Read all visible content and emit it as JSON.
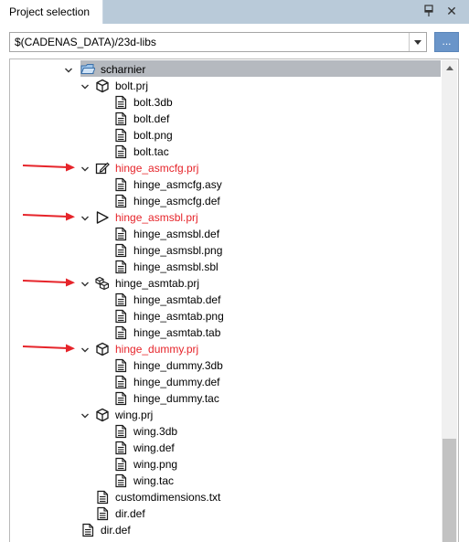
{
  "window": {
    "tab_title": "Project selection",
    "close_glyph": "✕"
  },
  "path": {
    "value": "$(CADENAS_DATA)/23d-libs",
    "browse_label": "..."
  },
  "colors": {
    "highlight_text": "#e6242a",
    "selected_row": "#b5b9bf",
    "arrow": "#e6242a"
  },
  "tree": [
    {
      "label": "scharnier",
      "icon": "folder-open-icon",
      "expanded": true,
      "selected": true
    },
    {
      "label": "bolt.prj",
      "icon": "cube-icon",
      "expanded": true
    },
    {
      "label": "bolt.3db",
      "icon": "document-icon"
    },
    {
      "label": "bolt.def",
      "icon": "document-icon"
    },
    {
      "label": "bolt.png",
      "icon": "document-icon"
    },
    {
      "label": "bolt.tac",
      "icon": "document-icon"
    },
    {
      "label": "hinge_asmcfg.prj",
      "icon": "edit-icon",
      "expanded": true,
      "highlighted": true
    },
    {
      "label": "hinge_asmcfg.asy",
      "icon": "document-icon"
    },
    {
      "label": "hinge_asmcfg.def",
      "icon": "document-icon"
    },
    {
      "label": "hinge_asmsbl.prj",
      "icon": "triangle-icon",
      "expanded": true,
      "highlighted": true
    },
    {
      "label": "hinge_asmsbl.def",
      "icon": "document-icon"
    },
    {
      "label": "hinge_asmsbl.png",
      "icon": "document-icon"
    },
    {
      "label": "hinge_asmsbl.sbl",
      "icon": "document-icon"
    },
    {
      "label": "hinge_asmtab.prj",
      "icon": "cubes-icon",
      "expanded": true
    },
    {
      "label": "hinge_asmtab.def",
      "icon": "document-icon"
    },
    {
      "label": "hinge_asmtab.png",
      "icon": "document-icon"
    },
    {
      "label": "hinge_asmtab.tab",
      "icon": "document-icon"
    },
    {
      "label": "hinge_dummy.prj",
      "icon": "cube-icon",
      "expanded": true,
      "highlighted": true
    },
    {
      "label": "hinge_dummy.3db",
      "icon": "document-icon"
    },
    {
      "label": "hinge_dummy.def",
      "icon": "document-icon"
    },
    {
      "label": "hinge_dummy.tac",
      "icon": "document-icon"
    },
    {
      "label": "wing.prj",
      "icon": "cube-icon",
      "expanded": true
    },
    {
      "label": "wing.3db",
      "icon": "document-icon"
    },
    {
      "label": "wing.def",
      "icon": "document-icon"
    },
    {
      "label": "wing.png",
      "icon": "document-icon"
    },
    {
      "label": "wing.tac",
      "icon": "document-icon"
    },
    {
      "label": "customdimensions.txt",
      "icon": "document-icon"
    },
    {
      "label": "dir.def",
      "icon": "document-icon"
    },
    {
      "label": "dir.def",
      "icon": "document-icon"
    }
  ]
}
